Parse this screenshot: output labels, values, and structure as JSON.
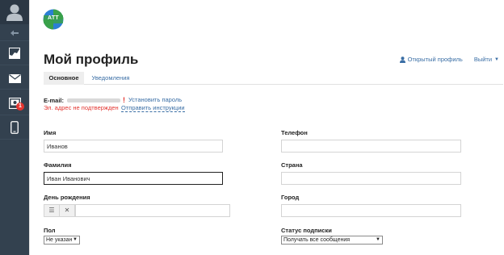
{
  "sidebar": {
    "items": [
      {
        "name": "avatar-icon"
      },
      {
        "name": "collapse-icon"
      },
      {
        "name": "chart-icon"
      },
      {
        "name": "mail-icon"
      },
      {
        "name": "inbox-icon",
        "badge": "1"
      },
      {
        "name": "phone-icon"
      }
    ]
  },
  "header": {
    "logo_text": "ATT",
    "title": "Мой профиль",
    "open_profile": "Открытый профиль",
    "logout": "Выйти"
  },
  "tabs": [
    {
      "label": "Основное",
      "active": true
    },
    {
      "label": "Уведомления",
      "active": false
    }
  ],
  "email": {
    "label": "E-mail:",
    "warn_mark": "!",
    "set_password": "Установить пароль",
    "unconfirmed": "Эл. адрес не подтвержден",
    "send_instructions": "Отправить инструкции"
  },
  "form": {
    "first_name": {
      "label": "Имя",
      "value": "Иванов"
    },
    "last_name": {
      "label": "Фамилия",
      "value": "Иван Иванович"
    },
    "birthday": {
      "label": "День рождения",
      "value": ""
    },
    "gender": {
      "label": "Пол",
      "value": "Не указан"
    },
    "phone": {
      "label": "Телефон",
      "value": ""
    },
    "country": {
      "label": "Страна",
      "value": ""
    },
    "city": {
      "label": "Город",
      "value": ""
    },
    "subscription": {
      "label": "Статус подписки",
      "value": "Получать все сообщения"
    }
  },
  "colors": {
    "sidebar": "#33414f",
    "link": "#3a6ea5",
    "error": "#e3342f",
    "logo_green": "#3aa14a",
    "logo_blue": "#2b7fd4"
  }
}
